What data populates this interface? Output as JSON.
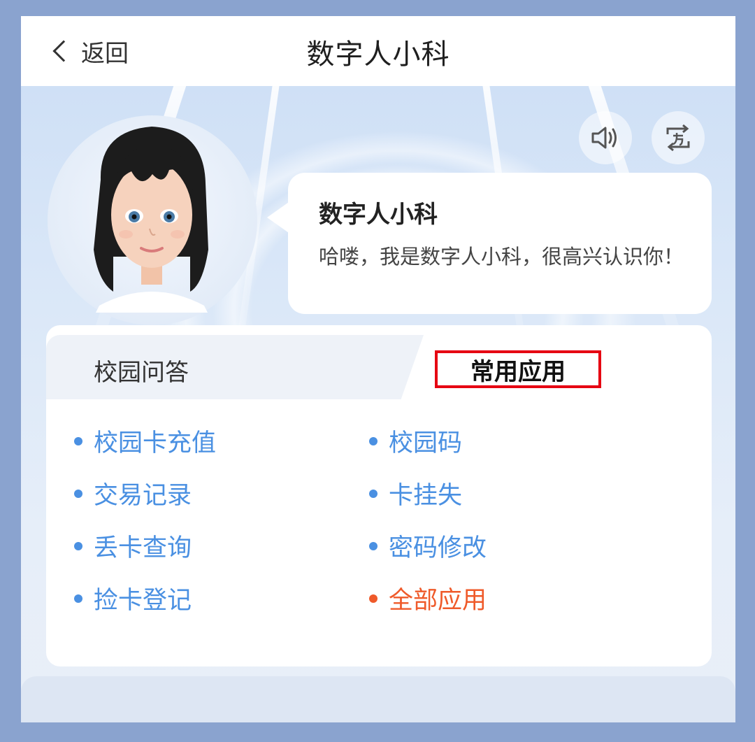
{
  "header": {
    "back_label": "返回",
    "title": "数字人小科"
  },
  "hero": {
    "sound_icon": "speaker-icon",
    "switch_icon": "switch-icon"
  },
  "bubble": {
    "name": "数字人小科",
    "greeting": "哈喽，我是数字人小科，很高兴认识你！"
  },
  "tabs": [
    {
      "label": "校园问答",
      "active": false
    },
    {
      "label": "常用应用",
      "active": true
    }
  ],
  "apps": [
    {
      "label": "校园卡充值"
    },
    {
      "label": "校园码"
    },
    {
      "label": "交易记录"
    },
    {
      "label": "卡挂失"
    },
    {
      "label": "丢卡查询"
    },
    {
      "label": "密码修改"
    },
    {
      "label": "捡卡登记"
    },
    {
      "label": "全部应用",
      "accent": true
    }
  ],
  "colors": {
    "accent": "#4a90e2",
    "highlight": "#ef5a2a",
    "outline": "#e60012"
  }
}
